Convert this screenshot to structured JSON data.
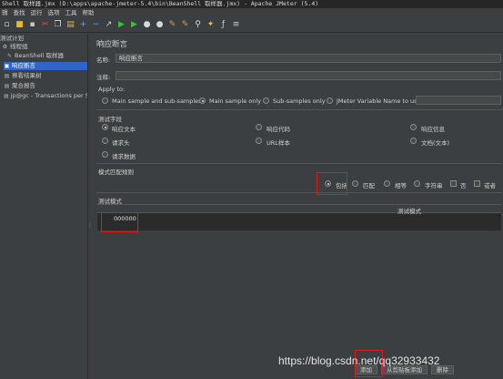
{
  "window": {
    "title": "Shell 取样器.jmx (D:\\apps\\apache-jmeter-5.4\\bin\\BeanShell 取样器.jmx) - Apache JMeter (5.4)"
  },
  "menu": [
    "辑",
    "查找",
    "运行",
    "选项",
    "工具",
    "帮助"
  ],
  "toolbar": [
    "new-icon",
    "open-icon",
    "save-icon",
    "cut-icon",
    "copy-icon",
    "paste-icon",
    "add-icon",
    "remove-icon",
    "expand-icon",
    "start-icon",
    "start-no-pause-icon",
    "stop-icon",
    "shutdown-icon",
    "clear-icon",
    "clear-all-icon",
    "search-icon",
    "broom-icon",
    "function-icon",
    "list-icon"
  ],
  "tree": [
    {
      "label": "测试计划",
      "icon": "test-plan-icon"
    },
    {
      "label": "线程组",
      "icon": "thread-group-icon"
    },
    {
      "label": "BeanShell 取样器",
      "icon": "sampler-icon"
    },
    {
      "label": "响应断言",
      "icon": "assertion-icon",
      "selected": true
    },
    {
      "label": "察看结果树",
      "icon": "listener-icon"
    },
    {
      "label": "聚合报告",
      "icon": "listener-icon"
    },
    {
      "label": "jp@gc - Transactions per S",
      "icon": "listener-icon"
    }
  ],
  "panel": {
    "title": "响应断言",
    "name_label": "名称:",
    "name_value": "响应断言",
    "comment_label": "注释:",
    "comment_value": "",
    "apply_to_label": "Apply to:",
    "apply_to": [
      "Main sample and sub-samples",
      "Main sample only",
      "Sub-samples only",
      "JMeter Variable Name to use"
    ],
    "apply_to_selected": 1,
    "field_label": "测试字段",
    "fields": [
      "响应文本",
      "响应代码",
      "响应信息",
      "请求头",
      "URL样本",
      "文档(文本)",
      "请求数据"
    ],
    "field_selected": 0,
    "match_rule_label": "模式匹配规则",
    "match_rules": [
      "包括",
      "匹配",
      "相等",
      "字符串"
    ],
    "match_rule_selected": 0,
    "not_label": "否",
    "or_label": "或者",
    "patterns_label": "测试模式",
    "patterns_col_header": "测试模式",
    "patterns": [
      "000000"
    ],
    "buttons": [
      "添加",
      "从剪贴板添加",
      "删除"
    ]
  },
  "watermark": "https://blog.csdn.net/qq32933432"
}
